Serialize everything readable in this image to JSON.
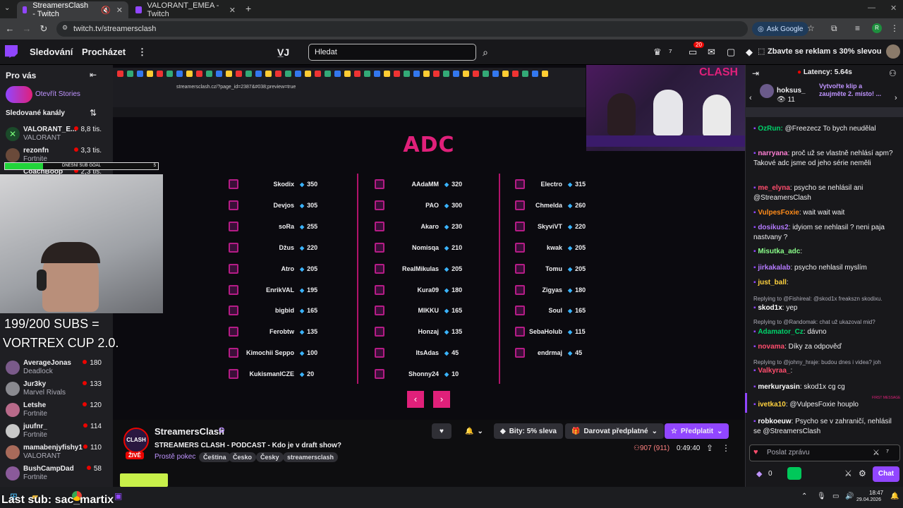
{
  "browser": {
    "tabs": [
      {
        "title": "StreamersClash - Twitch",
        "active": true
      },
      {
        "title": "VALORANT_EMEA - Twitch",
        "active": false
      }
    ],
    "url": "twitch.tv/streamersclash",
    "ask_google": "Ask Google"
  },
  "nav": {
    "following": "Sledování",
    "browse": "Procházet",
    "search_placeholder": "Hledat",
    "notifications_count": "20",
    "promo": "Zbavte se reklam s 30% slevou"
  },
  "sidebar": {
    "for_you": "Pro vás",
    "stories": "Otevřít Stories",
    "followed": "Sledované kanály",
    "channels": [
      {
        "name": "VALORANT_E...",
        "game": "VALORANT",
        "viewers": "8,8 tis."
      },
      {
        "name": "rezonfn",
        "game": "Fortnite",
        "viewers": "3,3 tis."
      },
      {
        "name": "CoachBoop",
        "game": "",
        "viewers": "2,3 tis."
      },
      {
        "name": "AverageJonas",
        "game": "Deadlock",
        "viewers": "180"
      },
      {
        "name": "Jur3ky",
        "game": "Marvel Rivals",
        "viewers": "133"
      },
      {
        "name": "Letshe",
        "game": "Fortnite",
        "viewers": "120"
      },
      {
        "name": "juufnr_",
        "game": "Fortnite",
        "viewers": "114"
      },
      {
        "name": "mamabenjyfishy1",
        "game": "VALORANT",
        "viewers": "110"
      },
      {
        "name": "BushCampDad",
        "game": "Fortnite",
        "viewers": "58"
      }
    ]
  },
  "stream": {
    "inner_url": "streamersclash.cz/?page_id=2387&#038;preview=true",
    "heading": "ADC",
    "sub_goal_label": "DNEŠNÍ SUB GOAL",
    "sub_goal_value": "5",
    "sub_goal_progress": 0.25,
    "overlay_line1": "199/200 SUBS =",
    "overlay_line2": "VORTREX CUP 2.0.",
    "columns": [
      [
        {
          "name": "Skodix",
          "val": "350"
        },
        {
          "name": "Devjos",
          "val": "305"
        },
        {
          "name": "soRa",
          "val": "255"
        },
        {
          "name": "Džus",
          "val": "220"
        },
        {
          "name": "Atro",
          "val": "205"
        },
        {
          "name": "EnrikVAL",
          "val": "195"
        },
        {
          "name": "bigbid",
          "val": "165"
        },
        {
          "name": "Ferobtw",
          "val": "135"
        },
        {
          "name": "Kimochii Seppo",
          "val": "100"
        },
        {
          "name": "KukismanICZE",
          "val": "20"
        }
      ],
      [
        {
          "name": "AAdaMM",
          "val": "320"
        },
        {
          "name": "PAO",
          "val": "300"
        },
        {
          "name": "Akaro",
          "val": "230"
        },
        {
          "name": "Nomisqa",
          "val": "210"
        },
        {
          "name": "RealMikulas",
          "val": "205"
        },
        {
          "name": "Kura09",
          "val": "180"
        },
        {
          "name": "MIKKU",
          "val": "165"
        },
        {
          "name": "Honzaj",
          "val": "135"
        },
        {
          "name": "ItsAdas",
          "val": "45"
        },
        {
          "name": "Shonny24",
          "val": "10"
        }
      ],
      [
        {
          "name": "Electro",
          "val": "315"
        },
        {
          "name": "Chmelda",
          "val": "260"
        },
        {
          "name": "SkyviVT",
          "val": "220"
        },
        {
          "name": "kwak",
          "val": "205"
        },
        {
          "name": "Tomu",
          "val": "205"
        },
        {
          "name": "Zigyas",
          "val": "180"
        },
        {
          "name": "Soul",
          "val": "165"
        },
        {
          "name": "SebaHolub",
          "val": "115"
        },
        {
          "name": "endrmaj",
          "val": "45"
        }
      ]
    ]
  },
  "info": {
    "channel": "StreamersClash",
    "live": "ŽIVĚ",
    "title": "STREAMERS CLASH - PODCAST - Kdo je v draft show?",
    "category": "Prostě pokec",
    "tags": [
      "Čeština",
      "Česko",
      "Česky",
      "streamersclash"
    ],
    "bits": "Bity: 5% sleva",
    "gift": "Darovat předplatné",
    "subscribe": "Předplatit",
    "viewers": "907 (911)",
    "uptime": "0:49:40",
    "avatar_text": "CLASH"
  },
  "chat": {
    "latency": "Latency: 5.64s",
    "hype_user": "hoksus_",
    "hype_count": "11",
    "hype_text": "Vytvořte klip a zaujměte 2. místo! ...",
    "messages": [
      {
        "user": "OzRun:",
        "color": "#00d26a",
        "text": " @Freezecz To bych neudělal"
      },
      {
        "user": "narryana",
        "color": "#ff7fd3",
        "text": ": proč už se vlastně nehlásí apm? Takové adc jsme od jeho série neměli"
      },
      {
        "user": "me_elyna",
        "color": "#ff4d6d",
        "text": ": psycho se nehlásil ani @StreamersClash"
      },
      {
        "user": "VulpesFoxie",
        "color": "#ff8c1a",
        "text": ": wait wait wait"
      },
      {
        "user": "dosikus2",
        "color": "#b57bff",
        "text": ": idyiom se nehlasil ? neni paja nastvany ?"
      },
      {
        "user": "Misutka_adc",
        "color": "#8aff8a",
        "text": ":"
      },
      {
        "user": "jirkakalab",
        "color": "#b57bff",
        "text": ": psycho nehlasil myslím"
      },
      {
        "user": "just_ball",
        "color": "#ffd23f",
        "text": ":"
      },
      {
        "user": "skod1x",
        "color": "#ffffff",
        "text": ": yep"
      },
      {
        "user": "Adamator_Cz",
        "color": "#00d26a",
        "text": ": dávno"
      },
      {
        "user": "novama",
        "color": "#ff4d6d",
        "text": ": Díky za odpověď"
      },
      {
        "user": "Valkyraa_",
        "color": "#ff4d6d",
        "text": ":"
      },
      {
        "user": "merkuryasin",
        "color": "#ffffff",
        "text": ": skod1x cg cg"
      },
      {
        "user": "ivetka10",
        "color": "#ffd23f",
        "text": ": @VulpesFoxie houplo"
      },
      {
        "user": "robkoeuw",
        "color": "#ffffff",
        "text": ": Psycho se v zahraničí, nehlásil se @StreamersClash"
      }
    ],
    "replies": [
      "Replying to @Fishireal: @skod1x freakszn skodixu.",
      "Replying to @Randomak: chat už ukazoval mid?",
      "Replying to @johny_hraje: budou dnes i videa? joh"
    ],
    "first_message": "FIRST MESSAGE",
    "input_placeholder": "Poslat zprávu",
    "points": "0",
    "chat_button": "Chat"
  },
  "taskbar": {
    "last_sub": "Last sub: sac_martix",
    "time": "18:47",
    "date": "29.04.2026"
  }
}
